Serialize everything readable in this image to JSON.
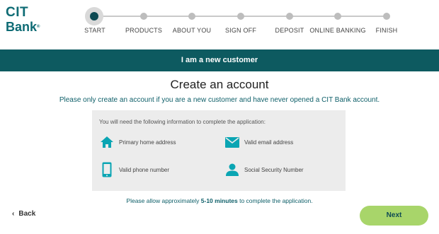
{
  "logo": {
    "line1": "CIT",
    "line2": "Bank"
  },
  "progress": {
    "steps": [
      {
        "label": "START",
        "active": true
      },
      {
        "label": "PRODUCTS",
        "active": false
      },
      {
        "label": "ABOUT YOU",
        "active": false
      },
      {
        "label": "SIGN OFF",
        "active": false
      },
      {
        "label": "DEPOSIT",
        "active": false
      },
      {
        "label": "ONLINE BANKING",
        "active": false
      },
      {
        "label": "FINISH",
        "active": false
      }
    ]
  },
  "banner": {
    "text": "I am a new customer"
  },
  "main": {
    "title": "Create an account",
    "subtitle": "Please only create an account if you are a new customer and have never opened a CIT Bank account."
  },
  "info": {
    "intro": "You will need the following information to complete the application:",
    "items": [
      {
        "icon": "home-icon",
        "label": "Primary home address"
      },
      {
        "icon": "email-icon",
        "label": "Valid email address"
      },
      {
        "icon": "phone-icon",
        "label": "Valid phone number"
      },
      {
        "icon": "person-icon",
        "label": "Social Security Number"
      }
    ]
  },
  "note": {
    "prefix": "Please allow approximately ",
    "bold": "5-10 minutes",
    "suffix": " to complete the application."
  },
  "nav": {
    "back_label": "Back",
    "next_label": "Next"
  },
  "colors": {
    "brand": "#0e6b74",
    "banner": "#0d5a60",
    "next_button": "#a8d56a",
    "icon": "#0aa5b3"
  }
}
